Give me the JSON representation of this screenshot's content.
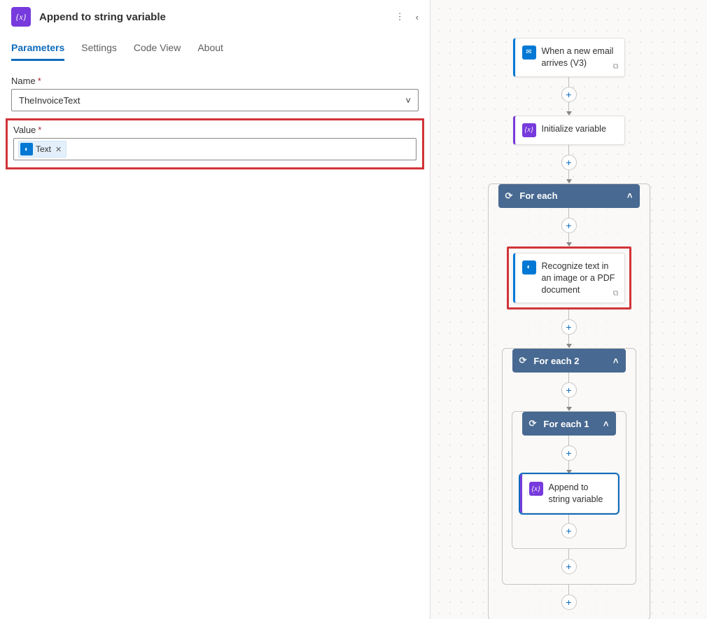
{
  "panel": {
    "title": "Append to string variable",
    "tabs": [
      "Parameters",
      "Settings",
      "Code View",
      "About"
    ],
    "active_tab_index": 0,
    "fields": {
      "name_label": "Name",
      "name_value": "TheInvoiceText",
      "value_label": "Value",
      "value_token": "Text"
    }
  },
  "flow": {
    "email_card": "When a new email arrives (V3)",
    "init_var_card": "Initialize variable",
    "for_each": "For each",
    "ocr_card": "Recognize text in an image or a PDF document",
    "for_each_2": "For each 2",
    "for_each_1": "For each 1",
    "append_card": "Append to string variable"
  },
  "icons": {
    "email": "✉",
    "variable": "{x}",
    "ocr": "◐",
    "loop": "⟳",
    "chev_up": "˄",
    "chev_left": "‹",
    "chev_down": "˅",
    "plus": "+",
    "more": "⋮",
    "link": "⧉"
  }
}
